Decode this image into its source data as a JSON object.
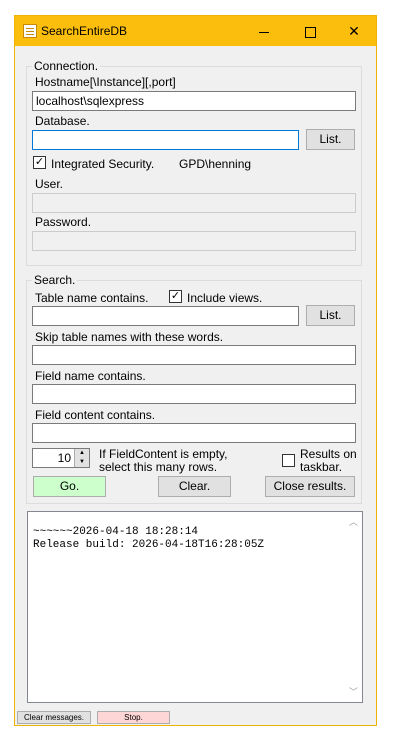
{
  "window": {
    "title": "SearchEntireDB"
  },
  "connection": {
    "legend": "Connection.",
    "hostname_label": "Hostname[\\Instance][,port]",
    "hostname_value": "localhost\\sqlexpress",
    "database_label": "Database.",
    "database_value": "",
    "list_button": "List.",
    "integrated_security_label": "Integrated Security.",
    "integrated_security_checked": true,
    "current_user": "GPD\\henning",
    "user_label": "User.",
    "password_label": "Password."
  },
  "search": {
    "legend": "Search.",
    "table_name_label": "Table name contains.",
    "include_views_label": "Include views.",
    "include_views_checked": true,
    "table_list_button": "List.",
    "skip_tables_label": "Skip table names with these words.",
    "field_name_label": "Field name contains.",
    "field_content_label": "Field content contains.",
    "rows_value": "10",
    "rows_hint_line1": "If FieldContent is empty,",
    "rows_hint_line2": "select this many rows.",
    "results_taskbar_line1": "Results on",
    "results_taskbar_line2": "taskbar.",
    "results_taskbar_checked": false,
    "go_button": "Go.",
    "clear_button": "Clear.",
    "close_results_button": "Close results."
  },
  "output": {
    "lines": [
      "~~~~~~2026-04-18 18:28:14",
      "Release build: 2026-04-18T16:28:05Z"
    ]
  },
  "footer": {
    "clear_messages_button": "Clear messages.",
    "stop_button": "Stop."
  },
  "colors": {
    "titlebar": "#fbbe0d",
    "go_button": "#ccffcc",
    "stop_button": "#ffd6d6"
  }
}
